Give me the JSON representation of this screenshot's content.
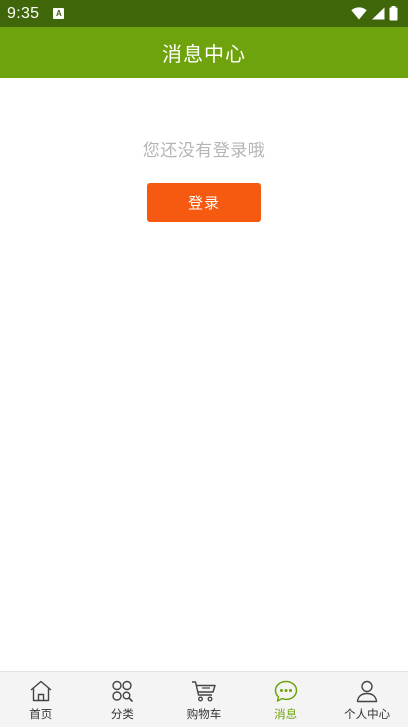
{
  "status_bar": {
    "time": "9:35",
    "badge": "A",
    "icons": [
      "wifi-icon",
      "cellular-signal-icon",
      "battery-icon"
    ]
  },
  "header": {
    "title": "消息中心"
  },
  "main": {
    "empty_message": "您还没有登录哦",
    "login_button_label": "登录"
  },
  "tab_bar": {
    "tabs": [
      {
        "label": "首页",
        "icon": "home-icon",
        "active": false
      },
      {
        "label": "分类",
        "icon": "category-icon",
        "active": false
      },
      {
        "label": "购物车",
        "icon": "cart-icon",
        "active": false
      },
      {
        "label": "消息",
        "icon": "message-icon",
        "active": true
      },
      {
        "label": "个人中心",
        "icon": "user-icon",
        "active": false
      }
    ]
  },
  "colors": {
    "status_bar_bg": "#3f6608",
    "header_bg": "#6fa30d",
    "accent": "#6fa30d",
    "login_button_bg": "#f55a10",
    "empty_text": "#b5b5b5"
  }
}
